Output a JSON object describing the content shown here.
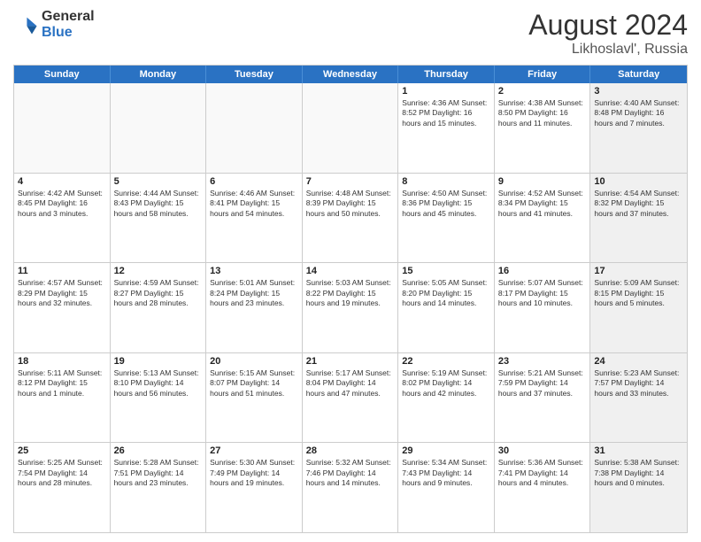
{
  "header": {
    "logo_line1": "General",
    "logo_line2": "Blue",
    "month": "August 2024",
    "location": "Likhoslavl', Russia"
  },
  "weekdays": [
    "Sunday",
    "Monday",
    "Tuesday",
    "Wednesday",
    "Thursday",
    "Friday",
    "Saturday"
  ],
  "rows": [
    [
      {
        "day": "",
        "text": "",
        "empty": true
      },
      {
        "day": "",
        "text": "",
        "empty": true
      },
      {
        "day": "",
        "text": "",
        "empty": true
      },
      {
        "day": "",
        "text": "",
        "empty": true
      },
      {
        "day": "1",
        "text": "Sunrise: 4:36 AM\nSunset: 8:52 PM\nDaylight: 16 hours\nand 15 minutes."
      },
      {
        "day": "2",
        "text": "Sunrise: 4:38 AM\nSunset: 8:50 PM\nDaylight: 16 hours\nand 11 minutes."
      },
      {
        "day": "3",
        "text": "Sunrise: 4:40 AM\nSunset: 8:48 PM\nDaylight: 16 hours\nand 7 minutes.",
        "shaded": true
      }
    ],
    [
      {
        "day": "4",
        "text": "Sunrise: 4:42 AM\nSunset: 8:45 PM\nDaylight: 16 hours\nand 3 minutes."
      },
      {
        "day": "5",
        "text": "Sunrise: 4:44 AM\nSunset: 8:43 PM\nDaylight: 15 hours\nand 58 minutes."
      },
      {
        "day": "6",
        "text": "Sunrise: 4:46 AM\nSunset: 8:41 PM\nDaylight: 15 hours\nand 54 minutes."
      },
      {
        "day": "7",
        "text": "Sunrise: 4:48 AM\nSunset: 8:39 PM\nDaylight: 15 hours\nand 50 minutes."
      },
      {
        "day": "8",
        "text": "Sunrise: 4:50 AM\nSunset: 8:36 PM\nDaylight: 15 hours\nand 45 minutes."
      },
      {
        "day": "9",
        "text": "Sunrise: 4:52 AM\nSunset: 8:34 PM\nDaylight: 15 hours\nand 41 minutes."
      },
      {
        "day": "10",
        "text": "Sunrise: 4:54 AM\nSunset: 8:32 PM\nDaylight: 15 hours\nand 37 minutes.",
        "shaded": true
      }
    ],
    [
      {
        "day": "11",
        "text": "Sunrise: 4:57 AM\nSunset: 8:29 PM\nDaylight: 15 hours\nand 32 minutes."
      },
      {
        "day": "12",
        "text": "Sunrise: 4:59 AM\nSunset: 8:27 PM\nDaylight: 15 hours\nand 28 minutes."
      },
      {
        "day": "13",
        "text": "Sunrise: 5:01 AM\nSunset: 8:24 PM\nDaylight: 15 hours\nand 23 minutes."
      },
      {
        "day": "14",
        "text": "Sunrise: 5:03 AM\nSunset: 8:22 PM\nDaylight: 15 hours\nand 19 minutes."
      },
      {
        "day": "15",
        "text": "Sunrise: 5:05 AM\nSunset: 8:20 PM\nDaylight: 15 hours\nand 14 minutes."
      },
      {
        "day": "16",
        "text": "Sunrise: 5:07 AM\nSunset: 8:17 PM\nDaylight: 15 hours\nand 10 minutes."
      },
      {
        "day": "17",
        "text": "Sunrise: 5:09 AM\nSunset: 8:15 PM\nDaylight: 15 hours\nand 5 minutes.",
        "shaded": true
      }
    ],
    [
      {
        "day": "18",
        "text": "Sunrise: 5:11 AM\nSunset: 8:12 PM\nDaylight: 15 hours\nand 1 minute."
      },
      {
        "day": "19",
        "text": "Sunrise: 5:13 AM\nSunset: 8:10 PM\nDaylight: 14 hours\nand 56 minutes."
      },
      {
        "day": "20",
        "text": "Sunrise: 5:15 AM\nSunset: 8:07 PM\nDaylight: 14 hours\nand 51 minutes."
      },
      {
        "day": "21",
        "text": "Sunrise: 5:17 AM\nSunset: 8:04 PM\nDaylight: 14 hours\nand 47 minutes."
      },
      {
        "day": "22",
        "text": "Sunrise: 5:19 AM\nSunset: 8:02 PM\nDaylight: 14 hours\nand 42 minutes."
      },
      {
        "day": "23",
        "text": "Sunrise: 5:21 AM\nSunset: 7:59 PM\nDaylight: 14 hours\nand 37 minutes."
      },
      {
        "day": "24",
        "text": "Sunrise: 5:23 AM\nSunset: 7:57 PM\nDaylight: 14 hours\nand 33 minutes.",
        "shaded": true
      }
    ],
    [
      {
        "day": "25",
        "text": "Sunrise: 5:25 AM\nSunset: 7:54 PM\nDaylight: 14 hours\nand 28 minutes."
      },
      {
        "day": "26",
        "text": "Sunrise: 5:28 AM\nSunset: 7:51 PM\nDaylight: 14 hours\nand 23 minutes."
      },
      {
        "day": "27",
        "text": "Sunrise: 5:30 AM\nSunset: 7:49 PM\nDaylight: 14 hours\nand 19 minutes."
      },
      {
        "day": "28",
        "text": "Sunrise: 5:32 AM\nSunset: 7:46 PM\nDaylight: 14 hours\nand 14 minutes."
      },
      {
        "day": "29",
        "text": "Sunrise: 5:34 AM\nSunset: 7:43 PM\nDaylight: 14 hours\nand 9 minutes."
      },
      {
        "day": "30",
        "text": "Sunrise: 5:36 AM\nSunset: 7:41 PM\nDaylight: 14 hours\nand 4 minutes."
      },
      {
        "day": "31",
        "text": "Sunrise: 5:38 AM\nSunset: 7:38 PM\nDaylight: 14 hours\nand 0 minutes.",
        "shaded": true
      }
    ]
  ]
}
